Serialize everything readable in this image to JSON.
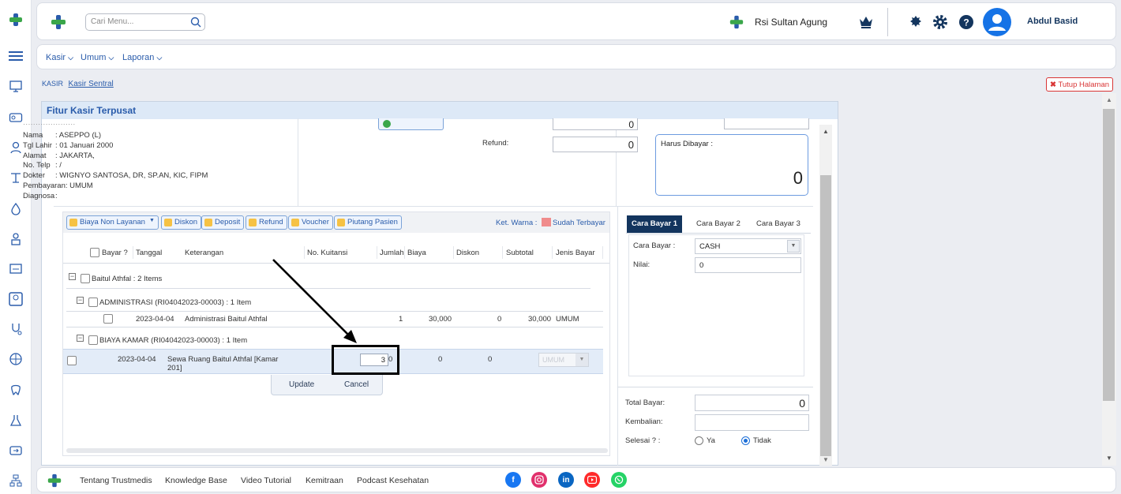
{
  "topbar": {
    "search_placeholder": "Cari Menu...",
    "hospital_name": "Rsi Sultan Agung",
    "user_name": "Abdul Basid"
  },
  "menubar": {
    "items": [
      {
        "label": "Kasir"
      },
      {
        "label": "Umum"
      },
      {
        "label": "Laporan"
      }
    ]
  },
  "breadcrumb": {
    "root": "KASIR",
    "current": "Kasir Sentral"
  },
  "close_page_label": "Tutup Halaman",
  "panel_title": "Fitur Kasir Terpusat",
  "patient": {
    "rows": [
      {
        "label": "Nama",
        "value": ": ASEPPO (L)"
      },
      {
        "label": "Tgl Lahir",
        "value": ": 01 Januari 2000"
      },
      {
        "label": "Alamat",
        "value": ": JAKARTA,"
      },
      {
        "label": "No. Telp",
        "value": ": /"
      },
      {
        "label": "Dokter",
        "value": ": WIGNYO SANTOSA, DR, SP.AN, KIC, FIPM"
      },
      {
        "label": "Pembayaran",
        "value": ": UMUM"
      },
      {
        "label": "Diagnosa",
        "value": ":"
      }
    ]
  },
  "summary": {
    "refund_label": "Refund:",
    "refund_value": "0",
    "top_value": "0",
    "harus_dibayar_label": "Harus Dibayar :",
    "harus_dibayar_value": "0"
  },
  "toolbar": {
    "biaya_non_layanan": "Biaya Non Layanan",
    "diskon": "Diskon",
    "deposit": "Deposit",
    "refund": "Refund",
    "voucher": "Voucher",
    "piutang": "Piutang Pasien",
    "ket_warna": "Ket. Warna :",
    "sudah_terbayar": "Sudah Terbayar",
    "paid_color": "#f08c8c"
  },
  "table": {
    "headers": [
      "Bayar ?",
      "Tanggal",
      "Keterangan",
      "No. Kuitansi",
      "Jumlah",
      "Biaya",
      "Diskon",
      "Subtotal",
      "Jenis Bayar"
    ],
    "group_label": "Baitul Athfal : 2 Items",
    "sub1_label": "ADMINISTRASI (RI04042023-00003) : 1 Item",
    "row1": {
      "tanggal": "2023-04-04",
      "keterangan": "Administrasi Baitul Athfal",
      "jumlah": "1",
      "biaya": "30,000",
      "diskon": "0",
      "subtotal": "30,000",
      "jenis": "UMUM"
    },
    "sub2_label": "BIAYA KAMAR (RI04042023-00003) : 1 Item",
    "row2": {
      "tanggal": "2023-04-04",
      "keterangan_1": "Sewa Ruang Baitul Athfal [Kamar",
      "keterangan_2": "201]",
      "jumlah": "3",
      "biaya": "0",
      "diskon": "0",
      "subtotal": "0",
      "jenis": "UMUM"
    },
    "update_label": "Update",
    "cancel_label": "Cancel"
  },
  "payment": {
    "tabs": [
      "Cara Bayar 1",
      "Cara Bayar 2",
      "Cara Bayar 3"
    ],
    "cara_bayar_label": "Cara Bayar :",
    "cara_bayar_value": "CASH",
    "nilai_label": "Nilai:",
    "nilai_value": "0",
    "total_bayar_label": "Total Bayar:",
    "total_bayar_value": "0",
    "kembalian_label": "Kembalian:",
    "kembalian_value": "",
    "selesai_label": "Selesai ? :",
    "ya_label": "Ya",
    "tidak_label": "Tidak"
  },
  "footer": {
    "links": [
      "Tentang Trustmedis",
      "Knowledge Base",
      "Video Tutorial",
      "Kemitraan",
      "Podcast Kesehatan"
    ]
  },
  "colors": {
    "brand_blue": "#2a5cab",
    "brand_green": "#3aa64a",
    "dark_navy": "#13355e"
  }
}
